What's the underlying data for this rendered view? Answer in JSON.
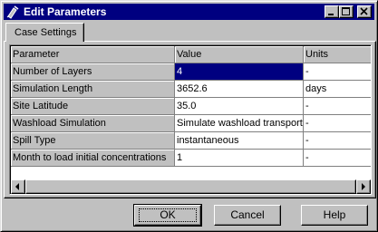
{
  "window": {
    "title": "Edit Parameters",
    "title_icon": "parameters-app-icon",
    "controls": [
      "minimize-icon",
      "maximize-icon",
      "close-icon"
    ]
  },
  "tabs": [
    {
      "label": "Case Settings",
      "active": true
    }
  ],
  "grid": {
    "columns": [
      "Parameter",
      "Value",
      "Units"
    ],
    "rows": [
      {
        "parameter": "Number of Layers",
        "value": "4",
        "units": "-",
        "selected": true
      },
      {
        "parameter": "Simulation Length",
        "value": "3652.6",
        "units": "days"
      },
      {
        "parameter": "Site Latitude",
        "value": "35.0",
        "units": "-"
      },
      {
        "parameter": "Washload Simulation",
        "value": "Simulate washload transport",
        "units": "-"
      },
      {
        "parameter": "Spill Type",
        "value": "instantaneous",
        "units": "-"
      },
      {
        "parameter": "Month to load initial concentrations",
        "value": "1",
        "units": "-"
      }
    ]
  },
  "buttons": {
    "ok": "OK",
    "cancel": "Cancel",
    "help": "Help"
  },
  "colors": {
    "titlebar": "#000080",
    "selection": "#000080",
    "face": "#c0c0c0"
  }
}
